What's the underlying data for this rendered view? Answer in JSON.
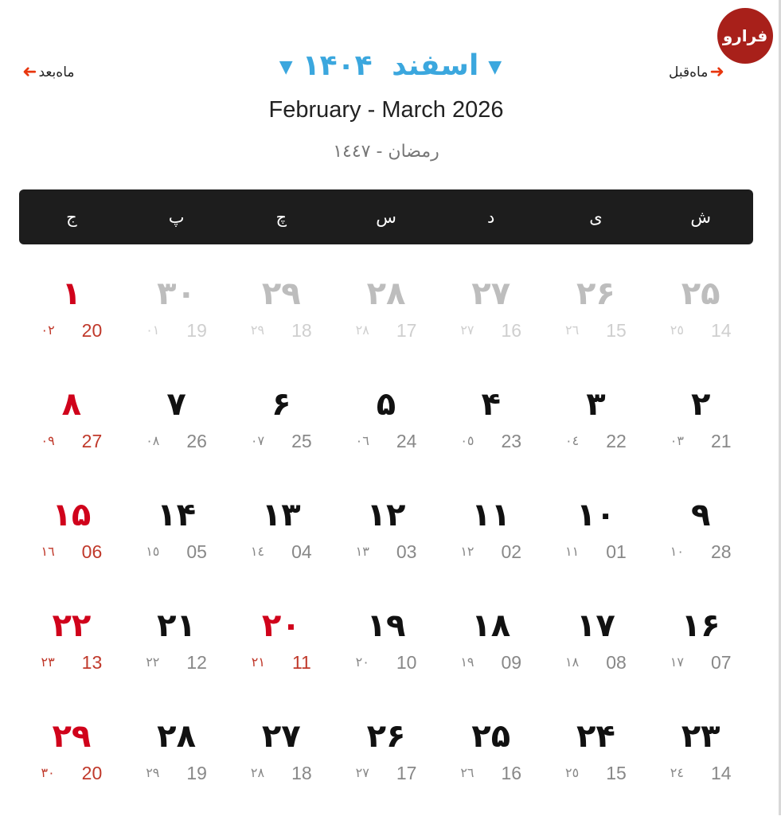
{
  "logo": {
    "text": "فرارو"
  },
  "header": {
    "prev_month_label": "ماه‌قبل",
    "next_month_label": "ماه‌بعد",
    "month": "اسفند",
    "year": "۱۴۰۴",
    "gregorian_range": "February - March 2026",
    "hijri_range": "رمضان - ١٤٤٧"
  },
  "colors": {
    "accent": "#3ba7de",
    "holiday": "#d0021b",
    "arrow": "#e8360e",
    "weekbar": "#1d1d1d"
  },
  "weekdays": [
    "ش",
    "ی",
    "د",
    "س",
    "چ",
    "پ",
    "ج"
  ],
  "weeks": [
    [
      {
        "day": "۲۵",
        "greg": "14",
        "hijri": "٢٥",
        "other": true
      },
      {
        "day": "۲۶",
        "greg": "15",
        "hijri": "٢٦",
        "other": true
      },
      {
        "day": "۲۷",
        "greg": "16",
        "hijri": "٢٧",
        "other": true
      },
      {
        "day": "۲۸",
        "greg": "17",
        "hijri": "٢٨",
        "other": true
      },
      {
        "day": "۲۹",
        "greg": "18",
        "hijri": "٢٩",
        "other": true
      },
      {
        "day": "۳۰",
        "greg": "19",
        "hijri": "٠١",
        "other": true
      },
      {
        "day": "۱",
        "greg": "20",
        "hijri": "٠٢",
        "holiday": true
      }
    ],
    [
      {
        "day": "۲",
        "greg": "21",
        "hijri": "٠٣"
      },
      {
        "day": "۳",
        "greg": "22",
        "hijri": "٠٤"
      },
      {
        "day": "۴",
        "greg": "23",
        "hijri": "٠٥"
      },
      {
        "day": "۵",
        "greg": "24",
        "hijri": "٠٦"
      },
      {
        "day": "۶",
        "greg": "25",
        "hijri": "٠٧"
      },
      {
        "day": "۷",
        "greg": "26",
        "hijri": "٠٨"
      },
      {
        "day": "۸",
        "greg": "27",
        "hijri": "٠٩",
        "holiday": true
      }
    ],
    [
      {
        "day": "۹",
        "greg": "28",
        "hijri": "١٠"
      },
      {
        "day": "۱۰",
        "greg": "01",
        "hijri": "١١"
      },
      {
        "day": "۱۱",
        "greg": "02",
        "hijri": "١٢"
      },
      {
        "day": "۱۲",
        "greg": "03",
        "hijri": "١٣"
      },
      {
        "day": "۱۳",
        "greg": "04",
        "hijri": "١٤"
      },
      {
        "day": "۱۴",
        "greg": "05",
        "hijri": "١٥"
      },
      {
        "day": "۱۵",
        "greg": "06",
        "hijri": "١٦",
        "holiday": true
      }
    ],
    [
      {
        "day": "۱۶",
        "greg": "07",
        "hijri": "١٧"
      },
      {
        "day": "۱۷",
        "greg": "08",
        "hijri": "١٨"
      },
      {
        "day": "۱۸",
        "greg": "09",
        "hijri": "١٩"
      },
      {
        "day": "۱۹",
        "greg": "10",
        "hijri": "٢٠"
      },
      {
        "day": "۲۰",
        "greg": "11",
        "hijri": "٢١",
        "holiday": true
      },
      {
        "day": "۲۱",
        "greg": "12",
        "hijri": "٢٢"
      },
      {
        "day": "۲۲",
        "greg": "13",
        "hijri": "٢٣",
        "holiday": true
      }
    ],
    [
      {
        "day": "۲۳",
        "greg": "14",
        "hijri": "٢٤"
      },
      {
        "day": "۲۴",
        "greg": "15",
        "hijri": "٢٥"
      },
      {
        "day": "۲۵",
        "greg": "16",
        "hijri": "٢٦"
      },
      {
        "day": "۲۶",
        "greg": "17",
        "hijri": "٢٧"
      },
      {
        "day": "۲۷",
        "greg": "18",
        "hijri": "٢٨"
      },
      {
        "day": "۲۸",
        "greg": "19",
        "hijri": "٢٩"
      },
      {
        "day": "۲۹",
        "greg": "20",
        "hijri": "٣٠",
        "holiday": true
      }
    ]
  ]
}
